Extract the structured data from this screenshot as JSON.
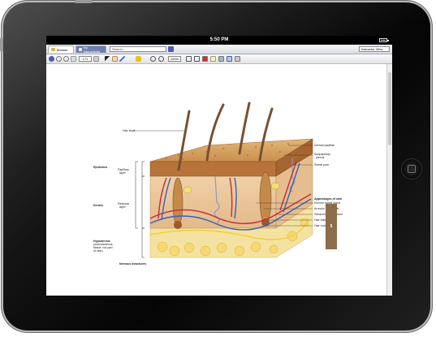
{
  "status": {
    "time": "5:50 PM"
  },
  "tabs": {
    "browse": "Browse",
    "my_interactives": "My Interactives"
  },
  "search": {
    "placeholder": "Search..."
  },
  "view_select": {
    "value": "Instructor View"
  },
  "toolbar": {
    "page": "171",
    "zoom": "100%"
  },
  "labels": {
    "hair_shaft": "Hair shaft",
    "epidermis": "Epidermis",
    "papillary_layer_1": "Papillary",
    "papillary_layer_2": "layer",
    "dermis": "Dermis",
    "reticular_layer_1": "Reticular",
    "reticular_layer_2": "layer",
    "hypodermis": "Hypodermis",
    "hypodermis_sub_1": "(subcutaneous",
    "hypodermis_sub_2": "tissue; not part",
    "hypodermis_sub_3": "of skin)",
    "nervous_structures": "Nervous structures",
    "dermal_papillae": "Dermal papillae",
    "subpapillary_1": "Subpapillary",
    "subpapillary_2": "plexus",
    "sweat_pore": "Sweat pore",
    "appendages": "Appendages of skin",
    "eccrine": "Eccrine sweat gland",
    "arrector": "Arrector pili muscle",
    "sebaceous": "Sebaceous (oil) gland",
    "follicle": "Hair follicle",
    "hair_root": "Hair root"
  },
  "page_tab": "5",
  "colors": {
    "tab_accent": "#6f7fb0",
    "page_tab": "#8c6c4a",
    "skin": "#d9a66b",
    "dermis": "#e8c9a0",
    "vessel_red": "#c8283a",
    "vessel_blue": "#3a5fb8"
  }
}
